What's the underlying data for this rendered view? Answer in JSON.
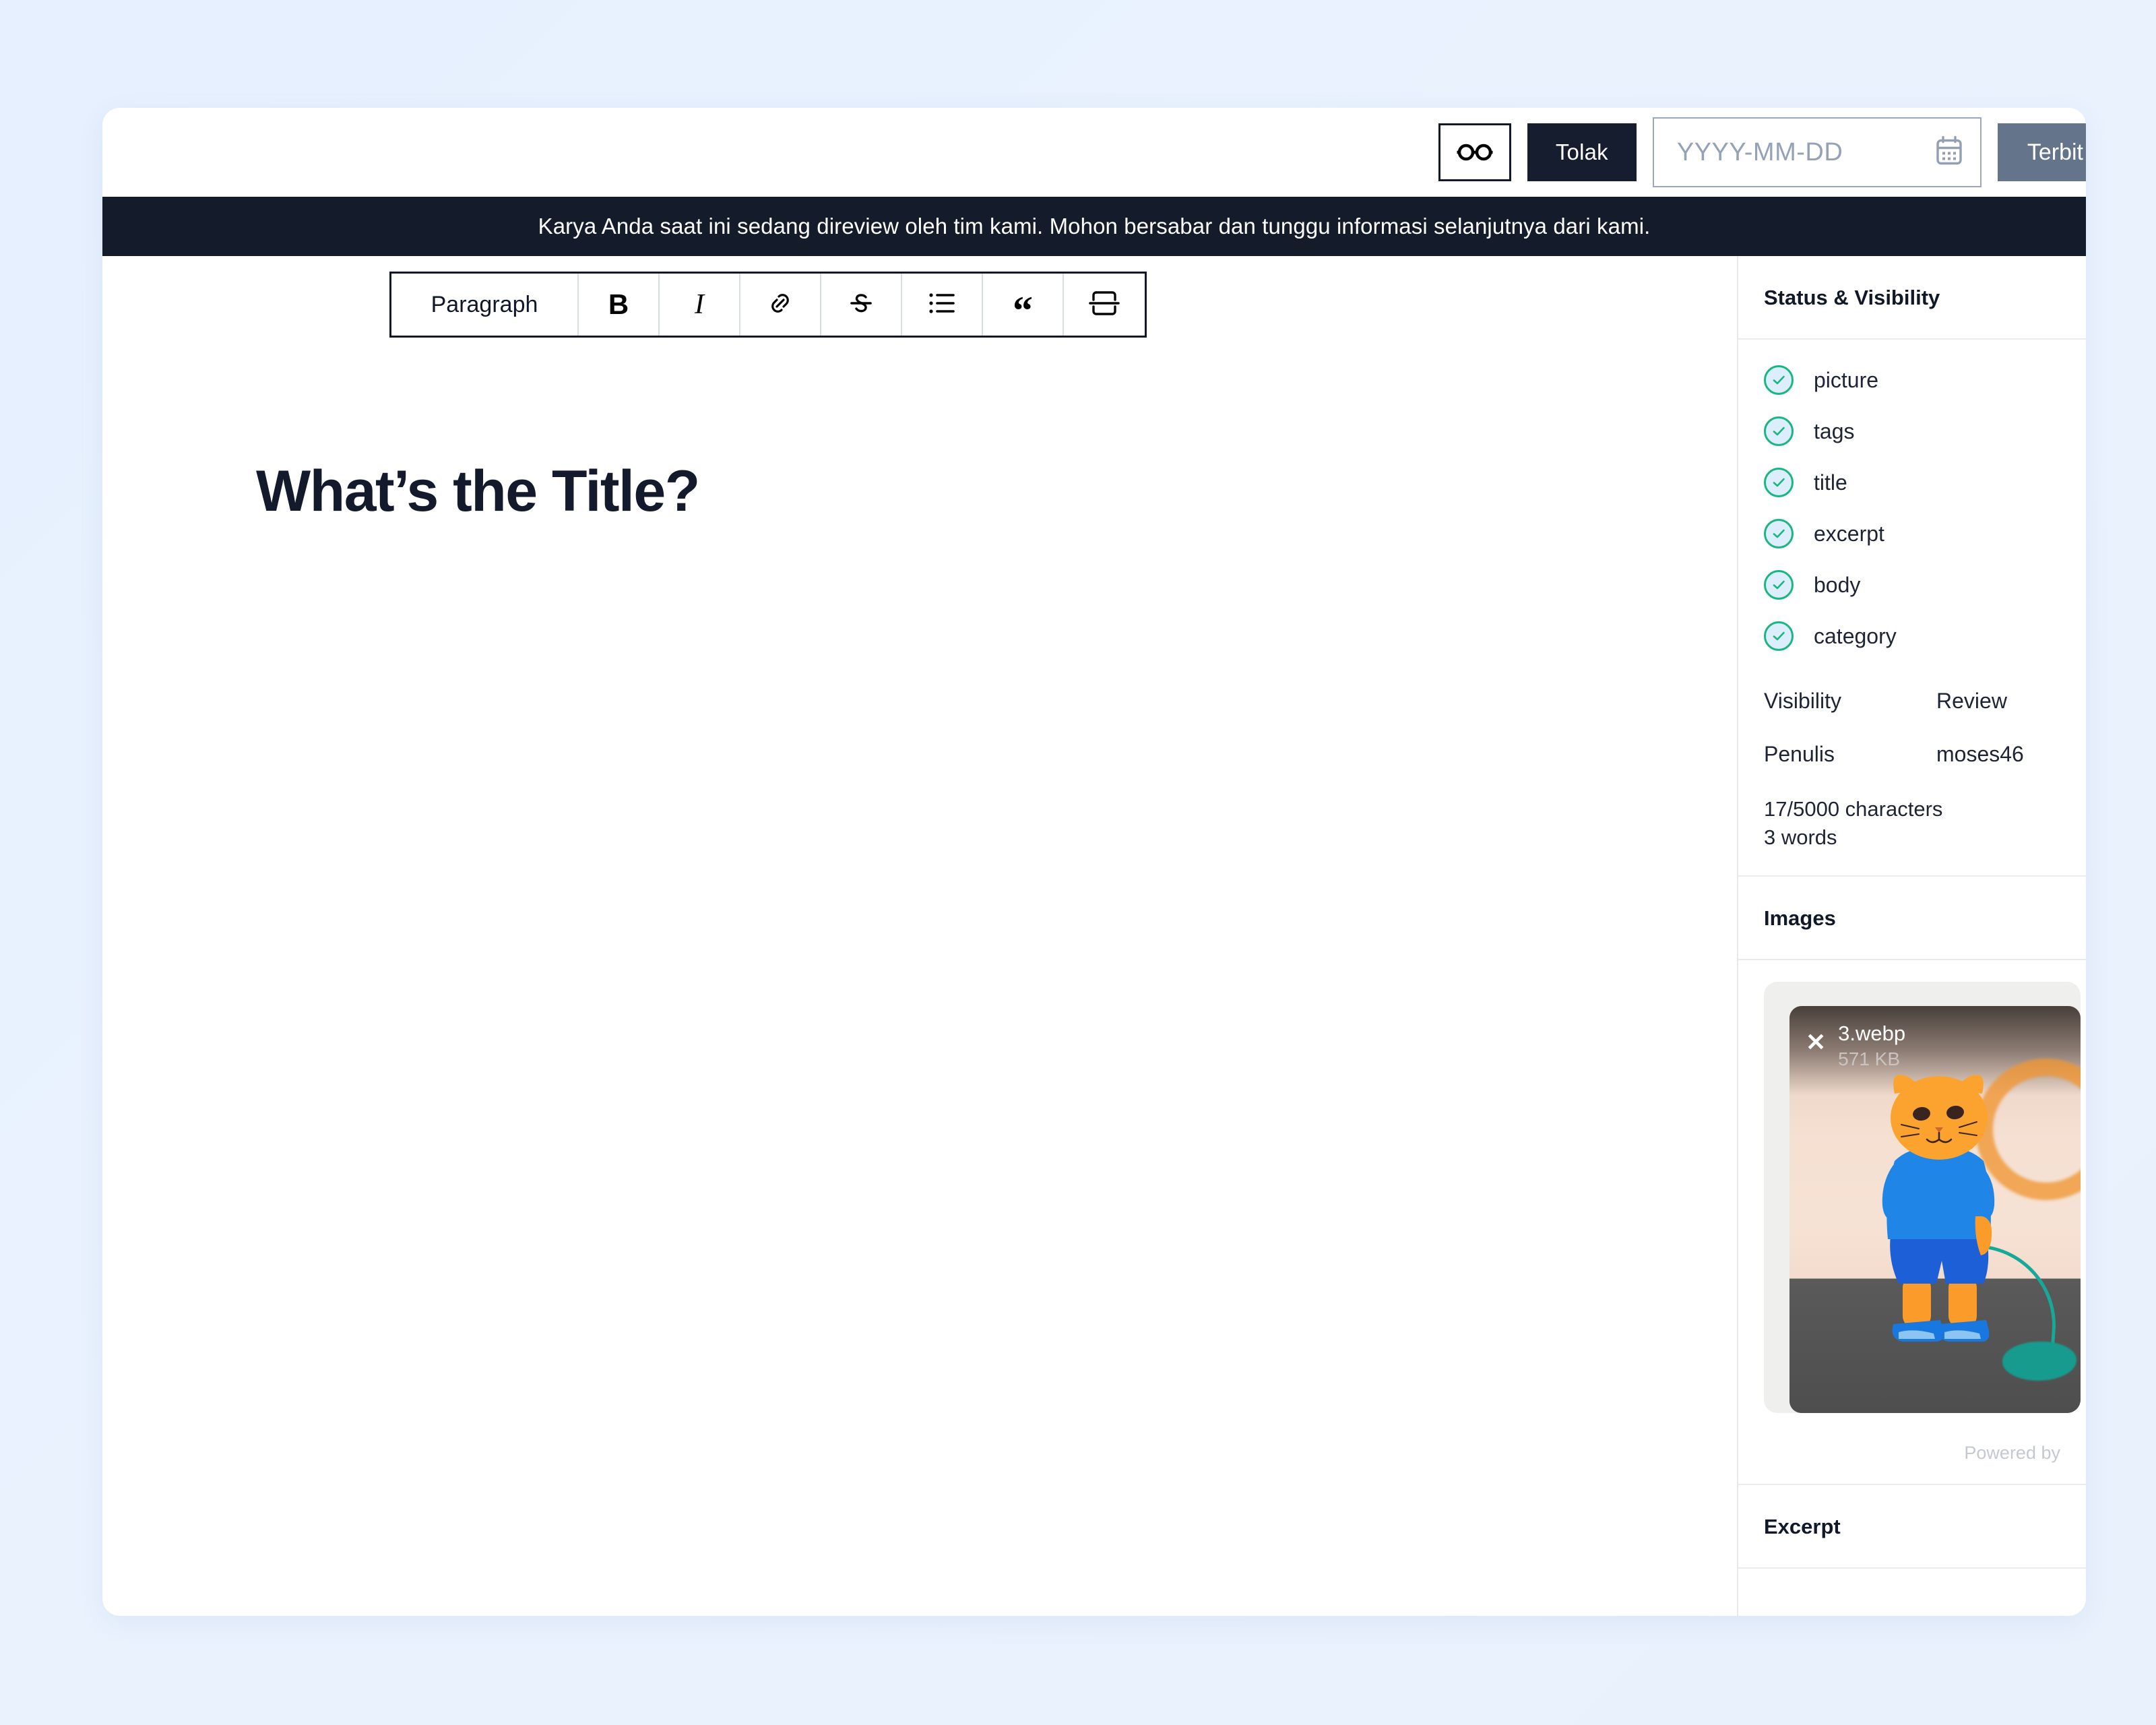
{
  "topbar": {
    "preview_icon": "glasses-icon",
    "reject_label": "Tolak",
    "date_placeholder": "YYYY-MM-DD",
    "date_value": "",
    "calendar_icon": "calendar-icon",
    "publish_label": "Terbit"
  },
  "banner": {
    "message": "Karya Anda saat ini sedang direview oleh tim kami. Mohon bersabar dan tunggu informasi selanjutnya dari kami."
  },
  "editor": {
    "toolbar": [
      {
        "name": "paragraph-style-select",
        "label": "Paragraph",
        "icon": ""
      },
      {
        "name": "bold-button",
        "label": "B",
        "icon": "bold-icon"
      },
      {
        "name": "italic-button",
        "label": "I",
        "icon": "italic-icon"
      },
      {
        "name": "link-button",
        "label": "",
        "icon": "link-icon"
      },
      {
        "name": "strikethrough-button",
        "label": "",
        "icon": "strikethrough-icon"
      },
      {
        "name": "bullet-list-button",
        "label": "",
        "icon": "list-icon"
      },
      {
        "name": "blockquote-button",
        "label": "“",
        "icon": "quote-icon"
      },
      {
        "name": "horizontal-rule-button",
        "label": "",
        "icon": "horizontal-rule-icon"
      }
    ],
    "title": "What’s the Title?",
    "body": ""
  },
  "sidebar": {
    "status_heading": "Status & Visibility",
    "checklist": [
      {
        "label": "picture",
        "checked": true
      },
      {
        "label": "tags",
        "checked": true
      },
      {
        "label": "title",
        "checked": true
      },
      {
        "label": "excerpt",
        "checked": true
      },
      {
        "label": "body",
        "checked": true
      },
      {
        "label": "category",
        "checked": true
      }
    ],
    "meta": [
      {
        "key": "Visibility",
        "value": "Review"
      },
      {
        "key": "Penulis",
        "value": "moses46"
      }
    ],
    "char_count": "17/5000 characters",
    "word_count": "3 words",
    "images_heading": "Images",
    "image": {
      "filename": "3.webp",
      "filesize": "571 KB",
      "close_icon": "close-icon"
    },
    "powered_by": "Powered by",
    "excerpt_heading": "Excerpt"
  },
  "colors": {
    "accent_dark": "#141c2c",
    "publish": "#64748b",
    "check_green": "#19b67f",
    "check_fill": "#dcedfb",
    "page_bg": "#eaf1fe"
  }
}
